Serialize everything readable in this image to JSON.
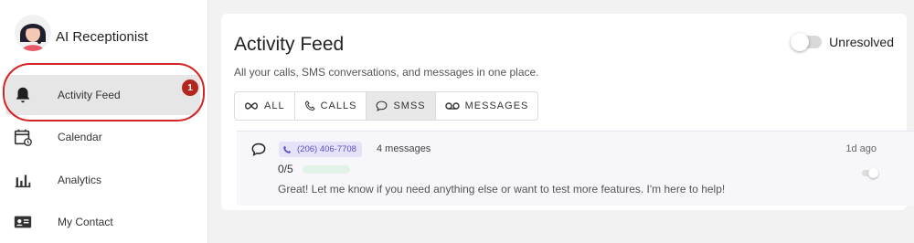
{
  "sidebar": {
    "brand": "AI Receptionist",
    "items": [
      {
        "label": "Activity Feed",
        "icon": "bell-icon",
        "badge": "1",
        "active": true
      },
      {
        "label": "Calendar",
        "icon": "calendar-icon"
      },
      {
        "label": "Analytics",
        "icon": "bar-chart-icon"
      },
      {
        "label": "My Contact",
        "icon": "contact-card-icon"
      }
    ]
  },
  "main": {
    "title": "Activity Feed",
    "subtitle": "All your calls, SMS conversations, and messages in one place.",
    "toggle_label": "Unresolved",
    "toggle_on": false,
    "tabs": [
      {
        "label": "ALL",
        "icon": "infinity-icon"
      },
      {
        "label": "CALLS",
        "icon": "phone-icon"
      },
      {
        "label": "SMSS",
        "icon": "chat-bubble-icon",
        "active": true
      },
      {
        "label": "MESSAGES",
        "icon": "voicemail-icon"
      }
    ],
    "feed": [
      {
        "phone": "(206) 406-7708",
        "message_count": "4 messages",
        "time": "1d ago",
        "score": "0/5",
        "score_fraction": 0,
        "preview": "Great! Let me know if you need anything else or want to test more features. I'm here to help!"
      }
    ]
  },
  "colors": {
    "badge": "#b3261e",
    "highlight_ring": "#d42323",
    "phone_chip_bg": "#e6e3f8",
    "phone_chip_text": "#5a4fc7",
    "score_bar": "#e3f2e6"
  }
}
